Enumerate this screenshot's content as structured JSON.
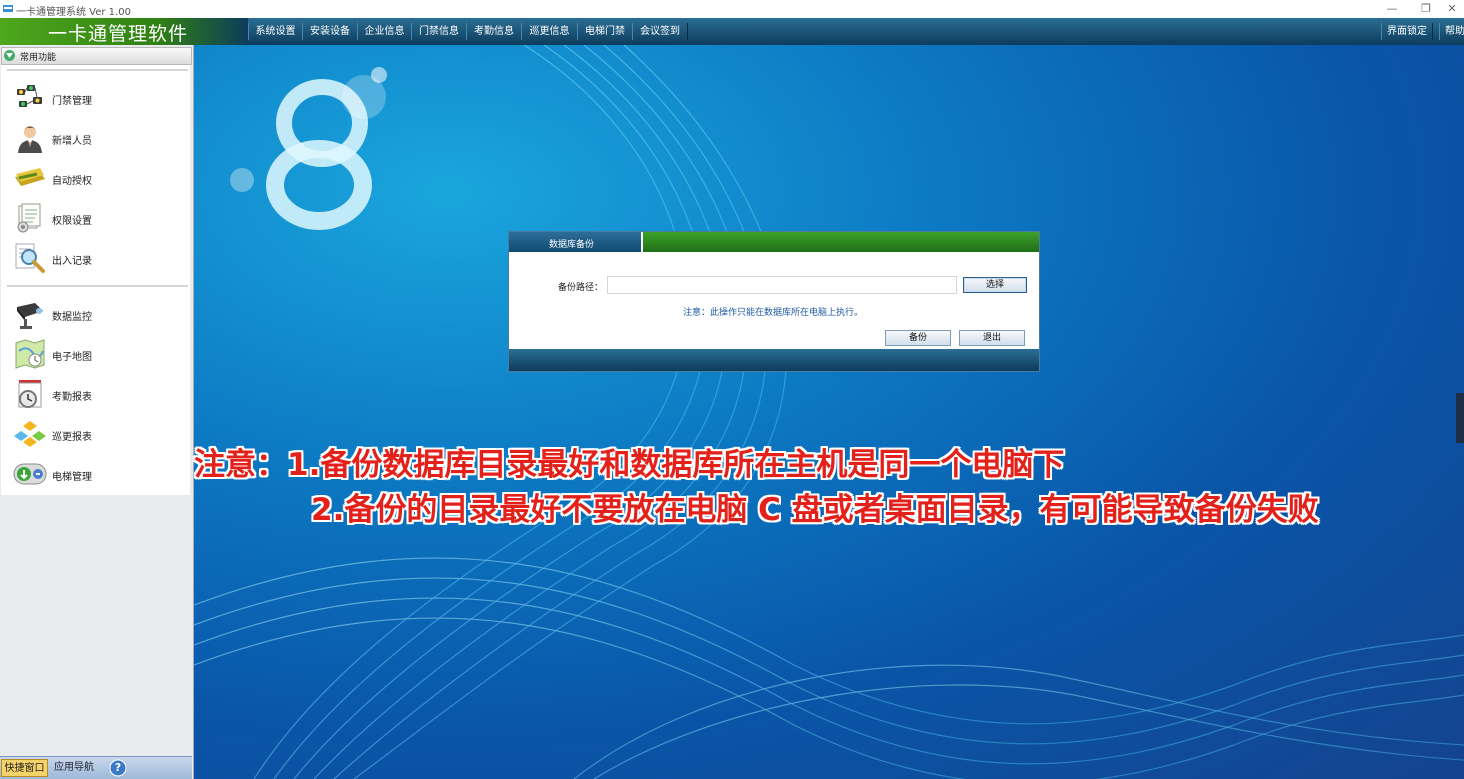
{
  "window": {
    "title": "一卡通管理系统  Ver 1.00",
    "controls": [
      "—",
      "❐",
      "✕"
    ]
  },
  "header": {
    "logo_text": "一卡通管理软件",
    "menu": [
      "系统设置",
      "安装设备",
      "企业信息",
      "门禁信息",
      "考勤信息",
      "巡更信息",
      "电梯门禁",
      "会议签到"
    ],
    "right_menu": [
      "界面锁定",
      "帮助"
    ]
  },
  "sidebar": {
    "panel_title": "常用功能",
    "group1": [
      {
        "label": "门禁管理",
        "icon": "door-access-icon"
      },
      {
        "label": "新增人员",
        "icon": "person-icon"
      },
      {
        "label": "自动授权",
        "icon": "card-icon"
      },
      {
        "label": "权限设置",
        "icon": "document-icon"
      },
      {
        "label": "出入记录",
        "icon": "magnifier-icon"
      }
    ],
    "group2": [
      {
        "label": "数据监控",
        "icon": "camera-icon"
      },
      {
        "label": "电子地图",
        "icon": "map-icon"
      },
      {
        "label": "考勤报表",
        "icon": "clock-icon"
      },
      {
        "label": "巡更报表",
        "icon": "patrol-icon"
      },
      {
        "label": "电梯管理",
        "icon": "elevator-icon"
      }
    ],
    "bottom_tabs": [
      "快捷窗口",
      "应用导航",
      "?"
    ]
  },
  "dialog": {
    "title": "数据库备份",
    "path_label": "备份路径：",
    "path_value": "",
    "choose_button": "选择",
    "note": "注意：此操作只能在数据库所在电脑上执行。",
    "backup_button": "备份",
    "exit_button": "退出"
  },
  "annotation": {
    "line1": "注意：1.备份数据库目录最好和数据库所在主机是同一个电脑下",
    "line2": "2.备份的目录最好不要放在电脑 C 盘或者桌面目录，有可能导致备份失败"
  },
  "colors": {
    "menu_bar": "#0d3c5c",
    "logo_green": "#3e9a1a",
    "annotation_red": "#e32019",
    "desktop_blue": "#0c78c2"
  }
}
